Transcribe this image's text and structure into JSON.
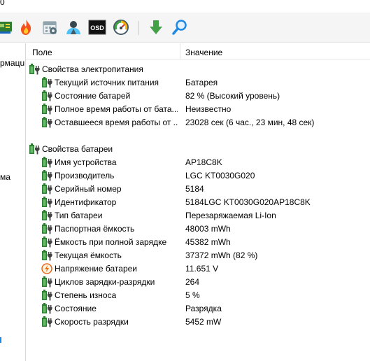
{
  "window": {
    "title_fragment": "0"
  },
  "toolbar": {
    "buttons": [
      {
        "name": "board-icon"
      },
      {
        "name": "flame-icon"
      },
      {
        "name": "calendar-icon"
      },
      {
        "name": "user-icon"
      },
      {
        "name": "osd-icon",
        "text": "OSD"
      },
      {
        "name": "gauge-icon"
      },
      {
        "name": "download-arrow-icon"
      },
      {
        "name": "magnifier-icon"
      }
    ]
  },
  "left_pane": {
    "item1": "рмацu",
    "item2": "ма"
  },
  "header": {
    "col_field": "Поле",
    "col_value": "Значение"
  },
  "groups": [
    {
      "title": "Свойства электропитания",
      "rows": [
        {
          "field": "Текущий источник питания",
          "value": "Батарея"
        },
        {
          "field": "Состояние батарей",
          "value": "82 % (Высокий уровень)"
        },
        {
          "field": "Полное время работы от бата...",
          "value": "Неизвестно"
        },
        {
          "field": "Оставшееся время работы от ...",
          "value": "23028 сек (6 час., 23 мин, 48 сек)"
        }
      ]
    },
    {
      "title": "Свойства батареи",
      "rows": [
        {
          "field": "Имя устройства",
          "value": "AP18C8K"
        },
        {
          "field": "Производитель",
          "value": "LGC KT0030G020"
        },
        {
          "field": "Серийный номер",
          "value": "5184"
        },
        {
          "field": "Идентификатор",
          "value": "5184LGC KT0030G020AP18C8K"
        },
        {
          "field": "Тип батареи",
          "value": "Перезаряжаемая Li-Ion"
        },
        {
          "field": "Паспортная ёмкость",
          "value": "48003 mWh"
        },
        {
          "field": "Ёмкость при полной зарядке",
          "value": "45382 mWh"
        },
        {
          "field": "Текущая ёмкость",
          "value": "37372 mWh  (82 %)"
        },
        {
          "field": "Напряжение батареи",
          "value": "11.651 V",
          "icon": "voltage"
        },
        {
          "field": "Циклов зарядки-разрядки",
          "value": "264"
        },
        {
          "field": "Степень износа",
          "value": "5 %"
        },
        {
          "field": "Состояние",
          "value": "Разрядка"
        },
        {
          "field": "Скорость разрядки",
          "value": "5452 mW"
        }
      ]
    }
  ]
}
